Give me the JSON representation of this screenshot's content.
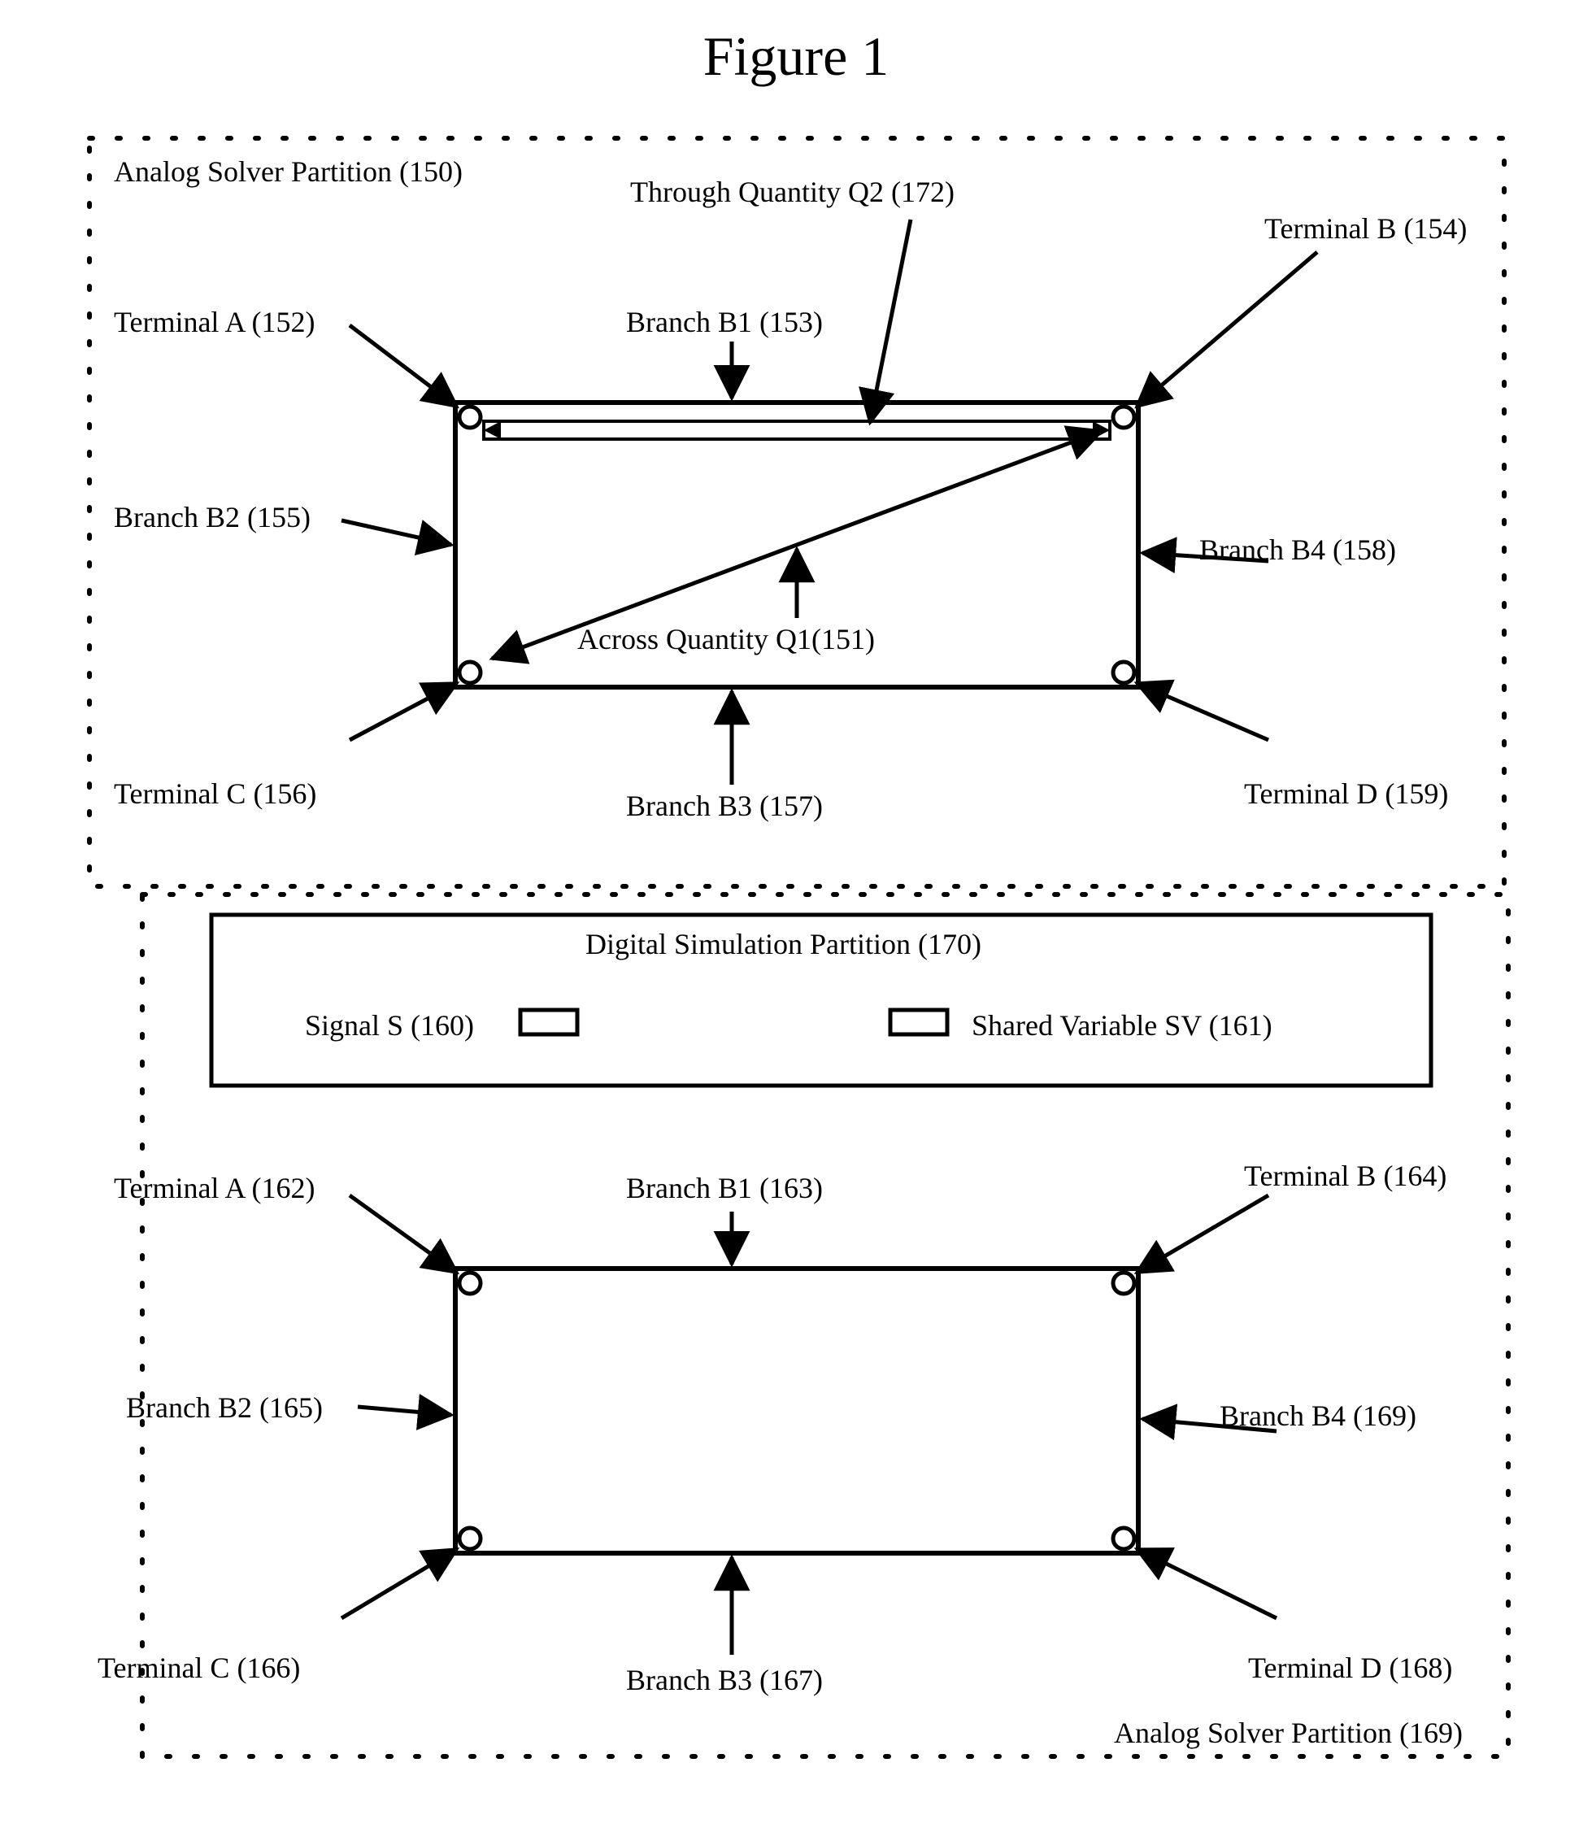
{
  "figure_title": "Figure 1",
  "top_partition": {
    "title": "Analog Solver Partition (150)",
    "terminal_a": "Terminal A (152)",
    "terminal_b": "Terminal B (154)",
    "terminal_c": "Terminal C (156)",
    "terminal_d": "Terminal D (159)",
    "branch_b1": "Branch B1 (153)",
    "branch_b2": "Branch B2 (155)",
    "branch_b3": "Branch B3 (157)",
    "branch_b4": "Branch B4 (158)",
    "through_q2": "Through Quantity Q2 (172)",
    "across_q1": "Across Quantity Q1(151)"
  },
  "middle_partition": {
    "title": "Digital Simulation Partition (170)",
    "signal_s": "Signal S (160)",
    "shared_var": "Shared Variable SV (161)"
  },
  "bottom_partition": {
    "title": "Analog Solver Partition (169)",
    "terminal_a": "Terminal A (162)",
    "terminal_b": "Terminal B (164)",
    "terminal_c": "Terminal C (166)",
    "terminal_d": "Terminal D (168)",
    "branch_b1": "Branch B1 (163)",
    "branch_b2": "Branch B2 (165)",
    "branch_b3": "Branch B3 (167)",
    "branch_b4": "Branch B4 (169)"
  }
}
